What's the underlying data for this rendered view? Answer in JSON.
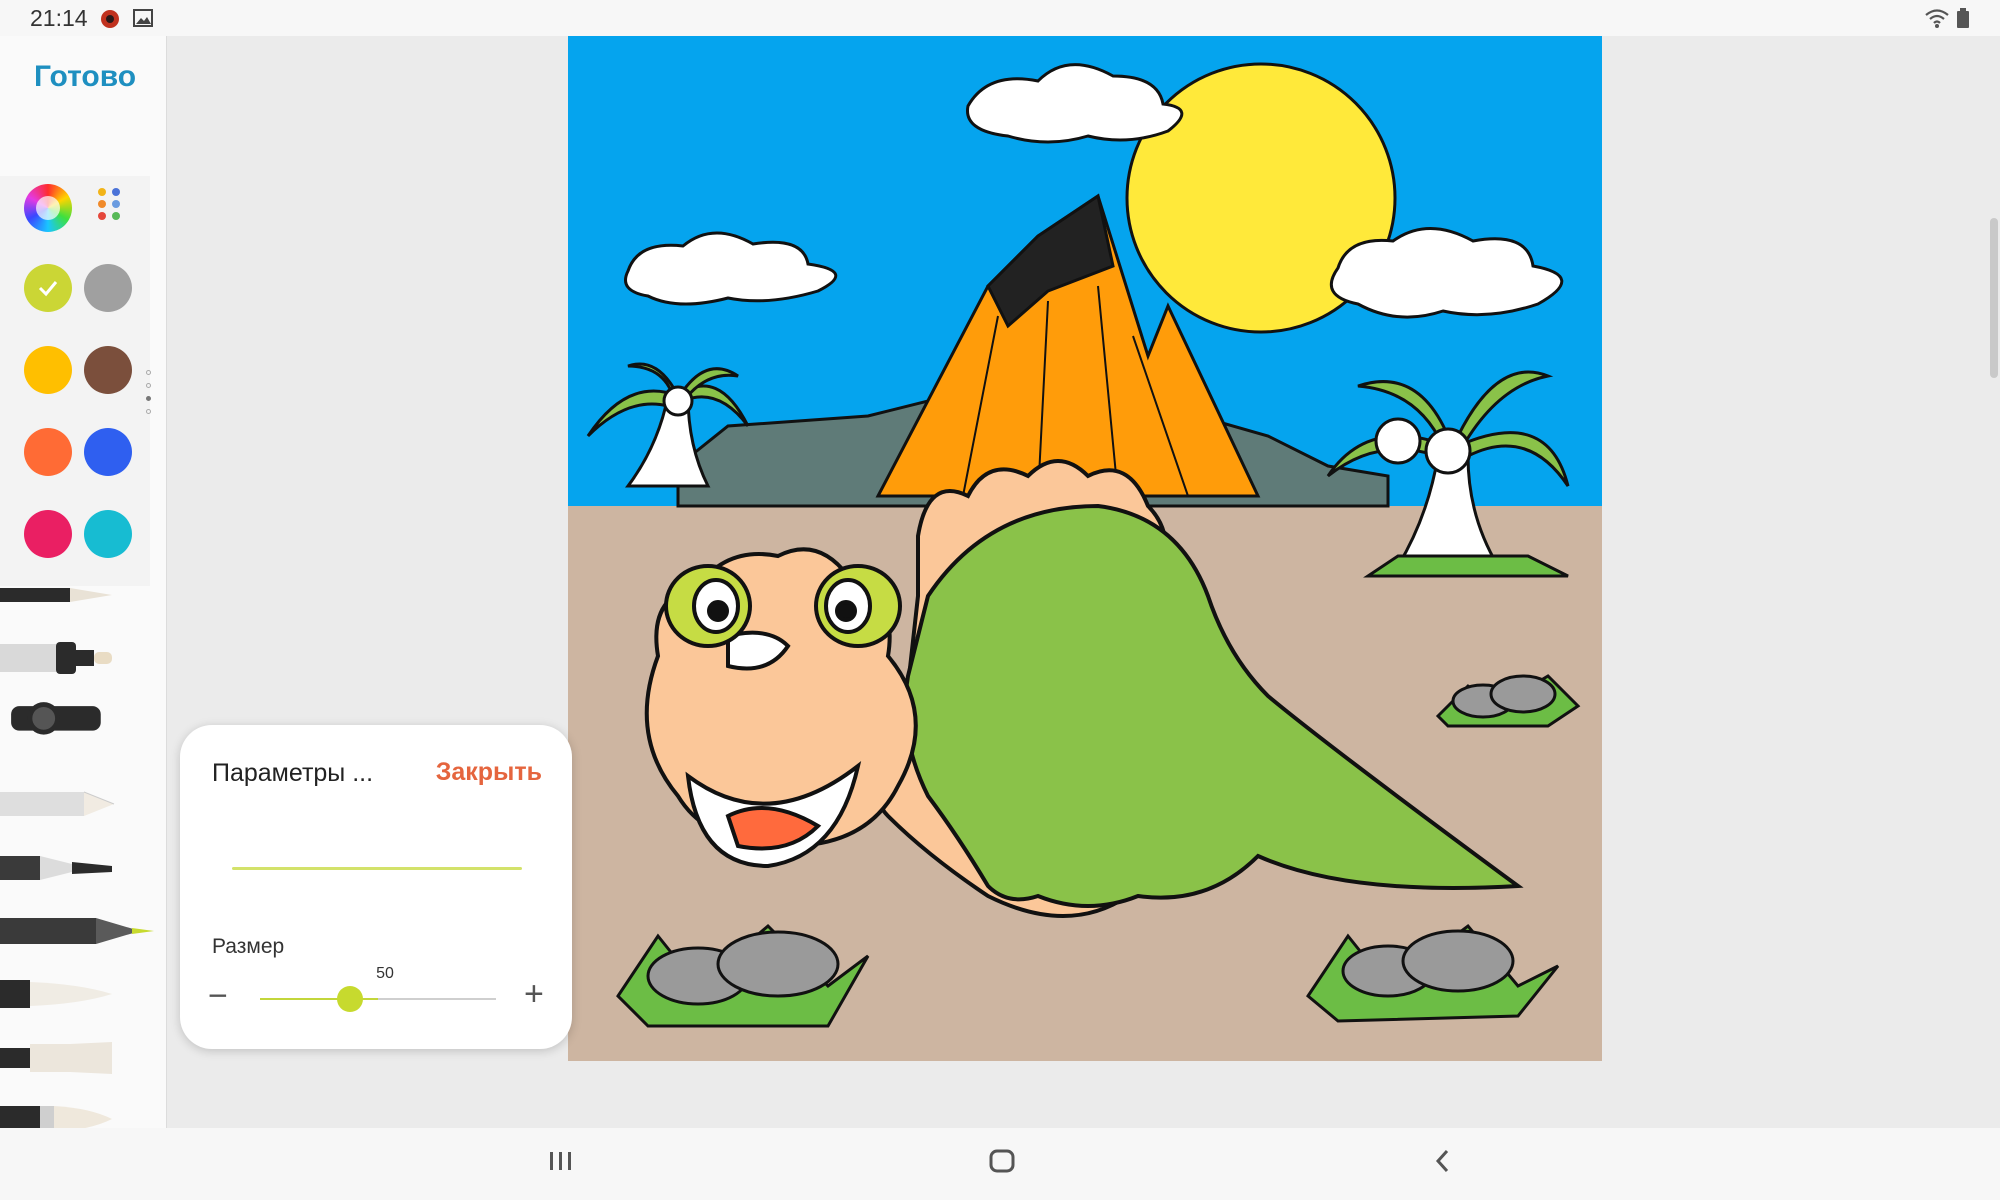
{
  "status": {
    "time": "21:14"
  },
  "sidebar": {
    "done_label": "Готово"
  },
  "colors": {
    "row1": [
      "#cbd635",
      "#a0a0a0"
    ],
    "row2": [
      "#ffbf00",
      "#7b4f3c"
    ],
    "row3": [
      "#ff6b35",
      "#2f5ff0"
    ],
    "row4": [
      "#ea1f63",
      "#17bcd2"
    ],
    "selected": "#cbd635",
    "accent": "#1e8fc0",
    "close": "#e5653e"
  },
  "popup": {
    "title": "Параметры ...",
    "close_label": "Закрыть",
    "size_label": "Размер",
    "size_value": "50"
  },
  "slider": {
    "value": 50,
    "max": 100
  },
  "icons": {
    "status": [
      "notification-icon",
      "gallery-icon",
      "wifi-icon",
      "battery-icon"
    ],
    "nav": [
      "recent-apps-icon",
      "home-icon",
      "back-icon"
    ],
    "tools": [
      "pen-tool",
      "marker-tool",
      "brush-tool",
      "pencil-tool",
      "calligraphy-pen-tool",
      "colored-pencil-tool",
      "fine-brush-tool",
      "flat-brush-tool",
      "watercolor-brush-tool"
    ]
  }
}
